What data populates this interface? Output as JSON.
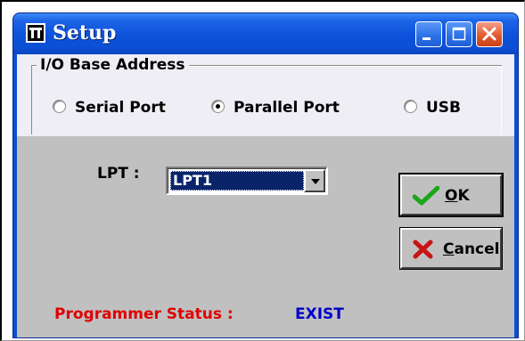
{
  "window": {
    "title": "Setup",
    "title_color": "#ffffff",
    "titlebar_color": "#0b52d9"
  },
  "title_buttons": {
    "minimize_icon": "minimize-icon",
    "maximize_icon": "maximize-icon",
    "close_icon": "close-icon"
  },
  "group": {
    "legend": "I/O Base Address",
    "options": [
      {
        "label": "Serial Port",
        "selected": false
      },
      {
        "label": "Parallel Port",
        "selected": true
      },
      {
        "label": "USB",
        "selected": false
      }
    ]
  },
  "lpt": {
    "label": "LPT :",
    "selected_value": "LPT1"
  },
  "buttons": {
    "ok": {
      "icon": "checkmark-icon",
      "mnemonic": "O",
      "rest": "K"
    },
    "cancel": {
      "icon": "x-icon",
      "mnemonic": "C",
      "rest": "ancel"
    }
  },
  "status": {
    "label": "Programmer Status :",
    "value": "EXIST",
    "label_color": "#e00000",
    "value_color": "#0000c8"
  }
}
